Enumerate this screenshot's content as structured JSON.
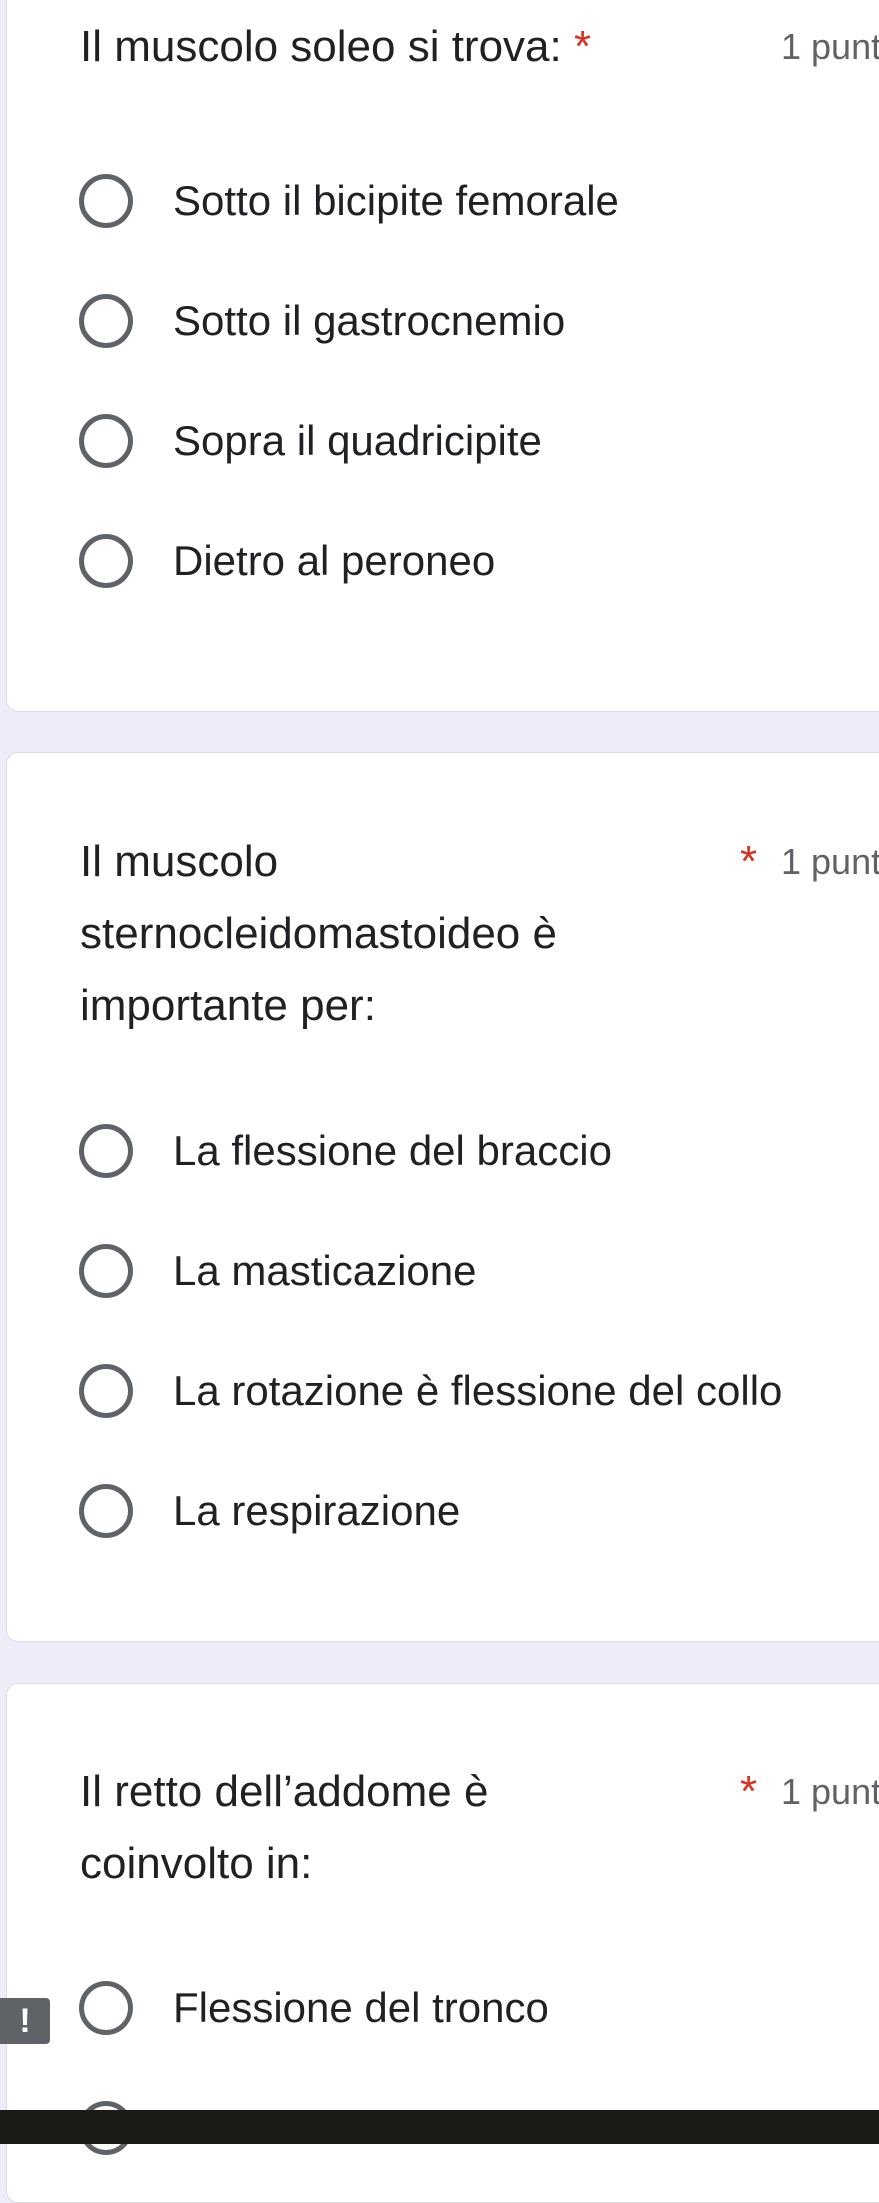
{
  "questions": [
    {
      "title_lines": [
        "Il muscolo soleo si trova:"
      ],
      "required_mark": "*",
      "points": "1 punt",
      "options": [
        "Sotto il bicipite femorale",
        "Sotto il gastrocnemio",
        "Sopra il quadricipite",
        "Dietro al peroneo"
      ]
    },
    {
      "title_lines": [
        "Il muscolo",
        "sternocleidomastoideo è",
        "importante per:"
      ],
      "required_mark": "*",
      "points": "1 punt",
      "options": [
        "La flessione del braccio",
        "La masticazione",
        "La rotazione è flessione del collo",
        "La respirazione"
      ]
    },
    {
      "title_lines": [
        "Il retto dell’addome è",
        "coinvolto in:"
      ],
      "required_mark": "*",
      "points": "1 punt",
      "options": [
        "Flessione del tronco"
      ]
    }
  ],
  "error_indicator": "!",
  "colors": {
    "page_background": "#f0ebf8",
    "card_background": "#ffffff",
    "required_asterisk": "#d93025",
    "radio_border": "#5f6368",
    "bottom_bar": "#1c1a17"
  }
}
